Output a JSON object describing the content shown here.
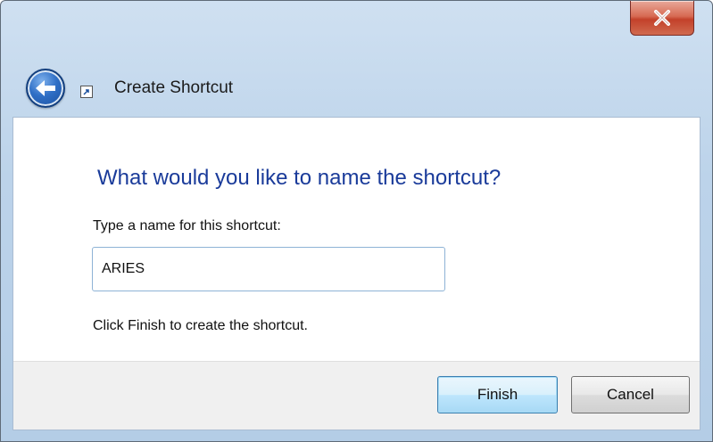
{
  "window": {
    "title": "Create Shortcut",
    "close_symbol": "x"
  },
  "icons": {
    "back": "back-arrow-icon",
    "shortcut": "shortcut-icon",
    "close": "close-icon"
  },
  "main": {
    "heading": "What would you like to name the shortcut?",
    "name_label": "Type a name for this shortcut:",
    "name_value": "ARIES",
    "hint": "Click Finish to create the shortcut."
  },
  "footer": {
    "finish_label": "Finish",
    "cancel_label": "Cancel"
  },
  "colors": {
    "heading": "#1a3b9a",
    "frame": "#bcd3ea",
    "close_button": "#c3412a",
    "finish_border": "#3c7fb1"
  }
}
